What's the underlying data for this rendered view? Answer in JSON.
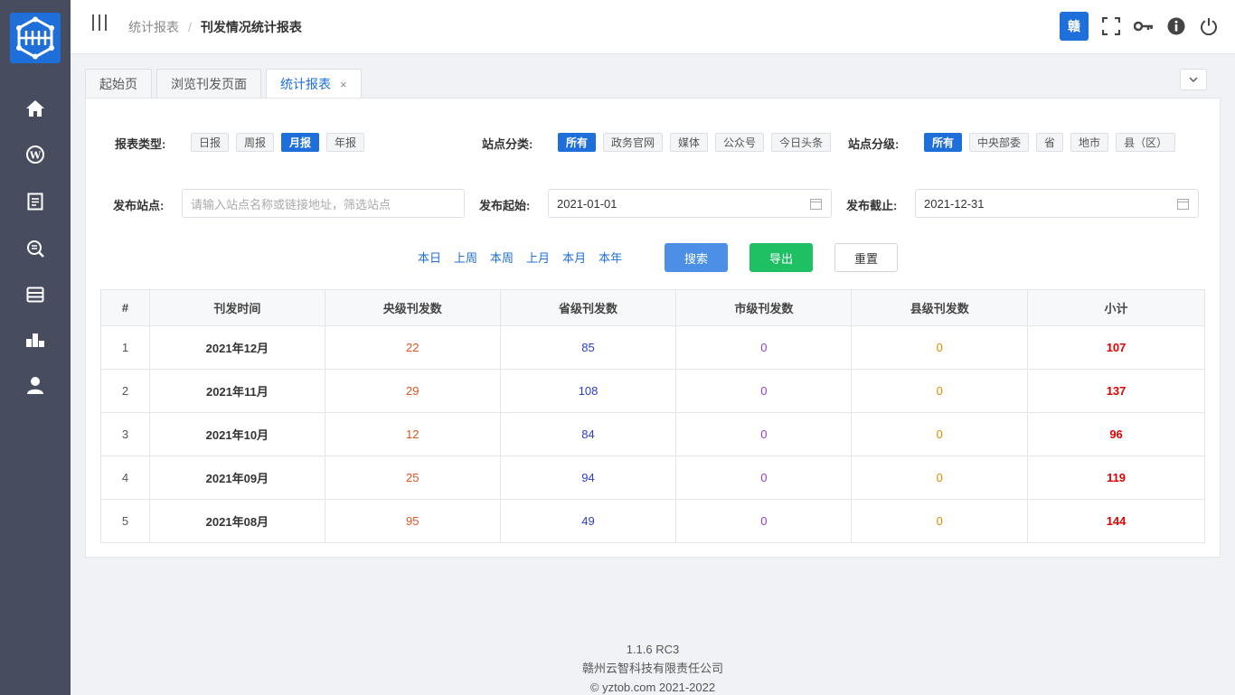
{
  "header": {
    "breadcrumb": [
      "统计报表",
      "刊发情况统计报表"
    ],
    "user_badge": "赣"
  },
  "tabs": [
    {
      "label": "起始页",
      "active": false
    },
    {
      "label": "浏览刊发页面",
      "active": false
    },
    {
      "label": "统计报表",
      "active": true,
      "close": "×"
    }
  ],
  "filters": {
    "report_type": {
      "label": "报表类型:",
      "options": [
        "日报",
        "周报",
        "月报",
        "年报"
      ],
      "selected": "月报"
    },
    "site_category": {
      "label": "站点分类:",
      "options": [
        "所有",
        "政务官网",
        "媒体",
        "公众号",
        "今日头条"
      ],
      "selected": "所有"
    },
    "site_level": {
      "label": "站点分级:",
      "options": [
        "所有",
        "中央部委",
        "省",
        "地市",
        "县（区）"
      ],
      "selected": "所有"
    },
    "site": {
      "label": "发布站点:",
      "placeholder": "请输入站点名称或链接地址，筛选站点"
    },
    "start": {
      "label": "发布起始:",
      "value": "2021-01-01"
    },
    "end": {
      "label": "发布截止:",
      "value": "2021-12-31"
    }
  },
  "quick_ranges": [
    "本日",
    "上周",
    "本周",
    "上月",
    "本月",
    "本年"
  ],
  "buttons": {
    "search": "搜索",
    "export": "导出",
    "reset": "重置"
  },
  "table": {
    "headers": [
      "#",
      "刊发时间",
      "央级刊发数",
      "省级刊发数",
      "市级刊发数",
      "县级刊发数",
      "小计"
    ],
    "rows": [
      [
        "1",
        "2021年12月",
        "22",
        "85",
        "0",
        "0",
        "107"
      ],
      [
        "2",
        "2021年11月",
        "29",
        "108",
        "0",
        "0",
        "137"
      ],
      [
        "3",
        "2021年10月",
        "12",
        "84",
        "0",
        "0",
        "96"
      ],
      [
        "4",
        "2021年09月",
        "25",
        "94",
        "0",
        "0",
        "119"
      ],
      [
        "5",
        "2021年08月",
        "95",
        "49",
        "0",
        "0",
        "144"
      ]
    ]
  },
  "footer": {
    "version": "1.1.6 RC3",
    "company": "赣州云智科技有限责任公司",
    "copyright": "© yztob.com 2021-2022"
  },
  "colors": {
    "primary": "#1e6fd9",
    "export": "#1fbf64",
    "sidebar": "#474d5e",
    "total": "#e00000"
  },
  "icons": [
    "home-icon",
    "wordpress-icon",
    "document-icon",
    "search-report-icon",
    "storage-icon",
    "chart-icon",
    "user-icon"
  ]
}
